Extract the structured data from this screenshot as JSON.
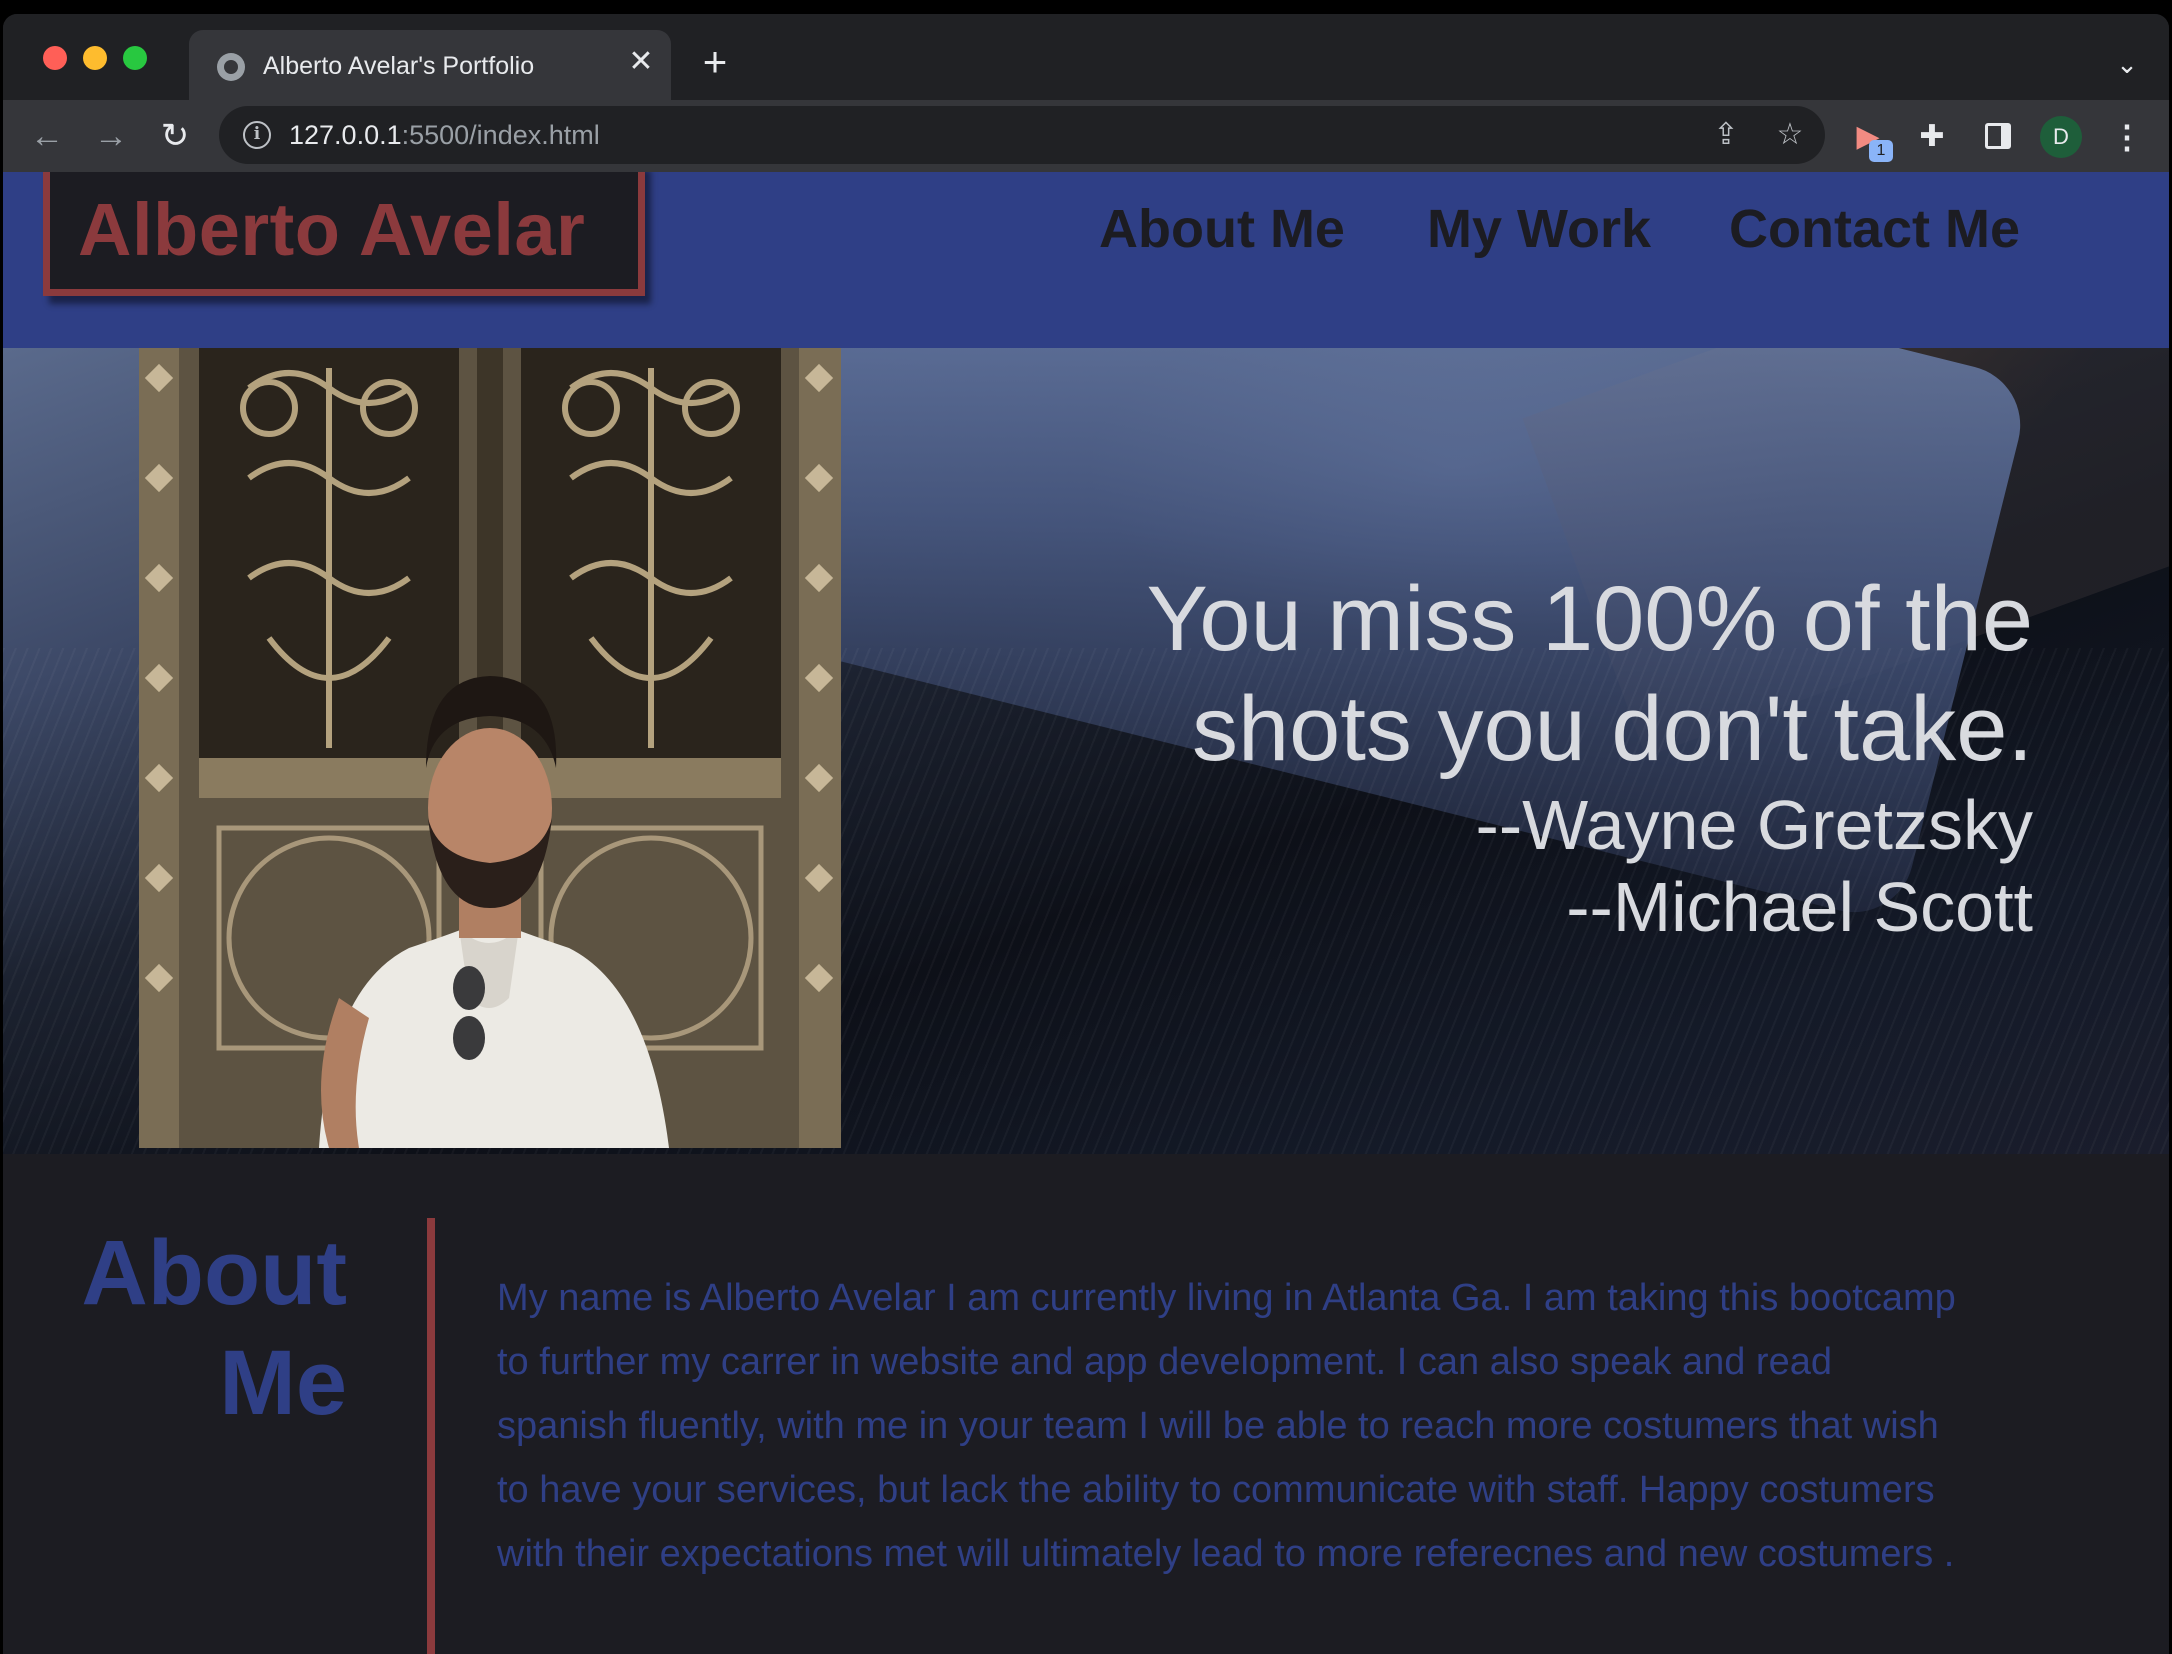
{
  "browser": {
    "tab_title": "Alberto Avelar's Portfolio",
    "tab_close": "✕",
    "new_tab": "+",
    "url_host": "127.0.0.1",
    "url_rest": ":5500/index.html",
    "extension_badge": "1",
    "profile_initial": "D"
  },
  "header": {
    "logo": "Alberto Avelar",
    "nav": {
      "about": "About Me",
      "work": "My Work",
      "contact": "Contact Me"
    }
  },
  "hero": {
    "quote_line1": "You miss 100% of the",
    "quote_line2": "shots you don't take.",
    "attribution1": "--Wayne Gretzsky",
    "attribution2": "--Michael Scott"
  },
  "about": {
    "heading_line1": "About",
    "heading_line2": "Me",
    "body": "My name is Alberto Avelar I am currently living in Atlanta Ga. I am taking this bootcamp to further my carrer in website and app development. I can also speak and read spanish fluently, with me in your team I will be able to reach more costumers that wish to have your services, but lack the ability to communicate with staff. Happy costumers with their expectations met will ultimately lead to more referecnes and new costumers ."
  },
  "colors": {
    "header_bg": "#2f3f86",
    "accent_red": "#8b3a3d",
    "page_bg": "#1c1c22",
    "quote_text": "#d8dadf"
  }
}
